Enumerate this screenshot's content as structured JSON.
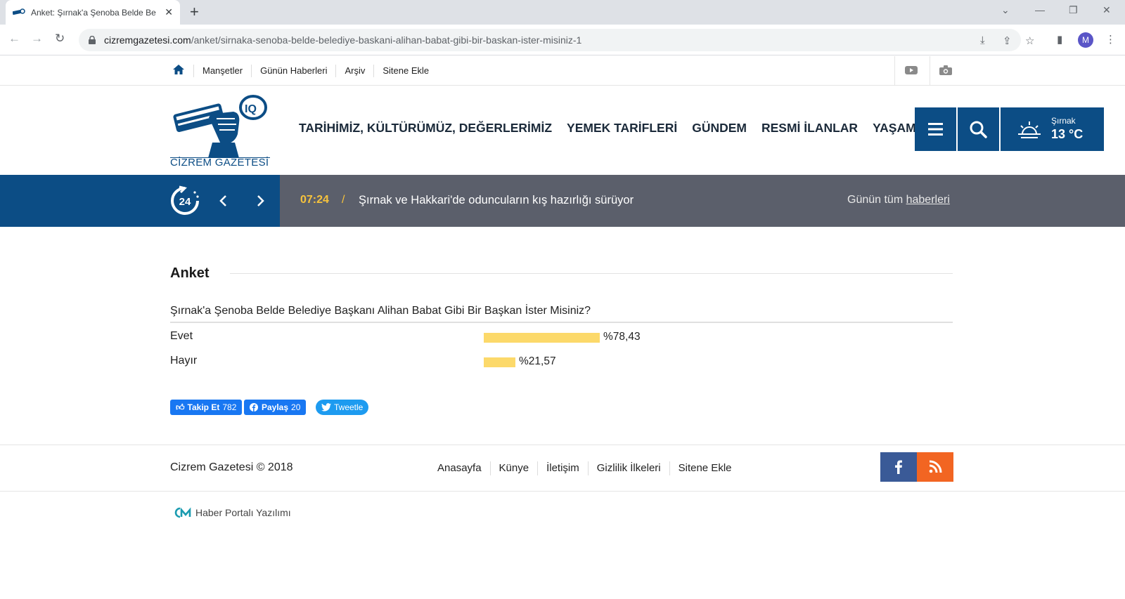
{
  "browser": {
    "tab_title": "Anket: Şırnak'a Şenoba Belde Be",
    "url_host": "cizremgazetesi.com",
    "url_path": "/anket/sirnaka-senoba-belde-belediye-baskani-alihan-babat-gibi-bir-baskan-ister-misiniz-1",
    "avatar_letter": "M"
  },
  "topnav": {
    "links": [
      "Manşetler",
      "Günün Haberleri",
      "Arşiv",
      "Sitene Ekle"
    ]
  },
  "header": {
    "logo_text": "CİZREM GAZETESİ",
    "nav": [
      "TARİHİMİZ, KÜLTÜRÜMÜZ, DEĞERLERİMİZ",
      "YEMEK TARİFLERİ",
      "GÜNDEM",
      "RESMİ İLANLAR",
      "YAŞAM"
    ],
    "weather": {
      "city": "Şırnak",
      "temp": "13 °C"
    }
  },
  "ticker": {
    "badge": "24",
    "time": "07:24",
    "separator": "/",
    "headline": "Şırnak ve Hakkari'de oduncuların kış hazırlığı sürüyor",
    "all_prefix": "Günün tüm ",
    "all_link": "haberleri"
  },
  "poll": {
    "title": "Anket",
    "question": "Şırnak'a Şenoba Belde Belediye Başkanı Alihan Babat Gibi Bir Başkan İster Misiniz?",
    "options": [
      {
        "label": "Evet",
        "percent_text": "%78,43",
        "value": 78.43
      },
      {
        "label": "Hayır",
        "percent_text": "%21,57",
        "value": 21.57
      }
    ]
  },
  "social": {
    "follow_label": "Takip Et",
    "follow_count": "782",
    "share_label": "Paylaş",
    "share_count": "20",
    "tweet_label": "Tweetle"
  },
  "footer": {
    "copyright": "Cizrem Gazetesi © 2018",
    "links": [
      "Anasayfa",
      "Künye",
      "İletişim",
      "Gizlilik İlkeleri",
      "Sitene Ekle"
    ],
    "powered": "Haber Portalı Yazılımı"
  },
  "colors": {
    "brand_blue": "#0c4d85",
    "ticker_gray": "#5b5f6b",
    "accent_yellow": "#f7c33c",
    "bar_yellow": "#fcd96a"
  }
}
